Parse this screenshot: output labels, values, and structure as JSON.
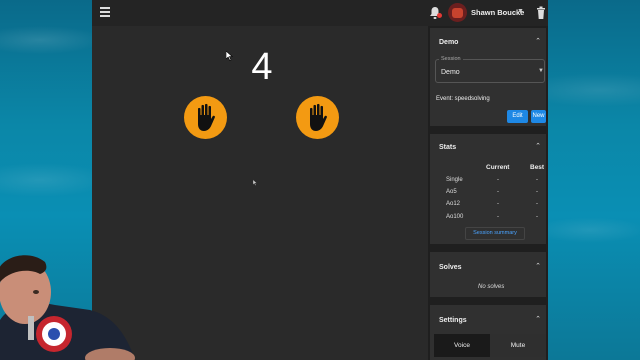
{
  "header": {
    "username": "Shawn Boucke"
  },
  "timer": {
    "countdown": "4"
  },
  "session_card": {
    "title": "Demo",
    "field_label": "Session",
    "field_value": "Demo",
    "event": "Event: speedsolving",
    "edit_label": "Edit",
    "new_label": "New"
  },
  "stats_card": {
    "title": "Stats",
    "columns": [
      "Current",
      "Best"
    ],
    "rows": [
      {
        "name": "Single",
        "current": "-",
        "best": "-"
      },
      {
        "name": "Ao5",
        "current": "-",
        "best": "-"
      },
      {
        "name": "Ao12",
        "current": "-",
        "best": "-"
      },
      {
        "name": "Ao100",
        "current": "-",
        "best": "-"
      }
    ],
    "summary_label": "Session summary"
  },
  "solves_card": {
    "title": "Solves",
    "empty_text": "No solves"
  },
  "settings_card": {
    "title": "Settings",
    "voice_label": "Voice",
    "mute_label": "Mute"
  },
  "colors": {
    "accent": "#1e88e5",
    "hand": "#f39a12",
    "panel": "#303030",
    "app_bg": "#2a2a2a"
  },
  "icons": [
    "menu-icon",
    "bell-icon",
    "avatar",
    "chevron-down-icon",
    "trash-icon",
    "hand-icon",
    "chevron-up-icon",
    "cursor-icon"
  ]
}
